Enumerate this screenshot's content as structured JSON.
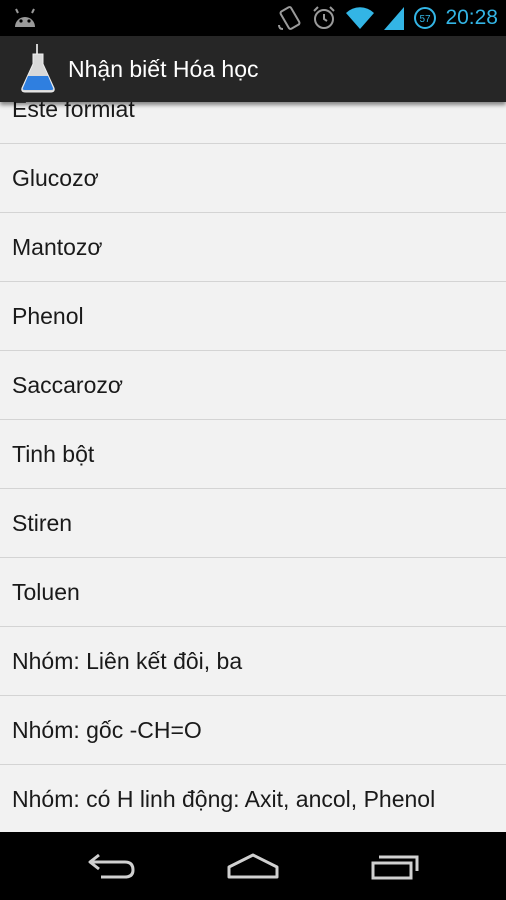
{
  "status_bar": {
    "time": "20:28",
    "battery_level": "57",
    "icons": [
      "android-debug-icon",
      "rotation-lock-icon",
      "alarm-icon",
      "wifi-icon",
      "signal-icon",
      "battery-icon"
    ],
    "accent_color": "#33b5e5"
  },
  "action_bar": {
    "title": "Nhận biết Hóa học",
    "icon": "flask-icon",
    "background": "#262626"
  },
  "list": {
    "items": [
      "Este formiat",
      "Glucozơ",
      "Mantozơ",
      "Phenol",
      "Saccarozơ",
      "Tinh bột",
      "Stiren",
      "Toluen",
      "Nhóm: Liên kết đôi, ba",
      "Nhóm: gốc -CH=O",
      "Nhóm: có H linh động: Axit, ancol, Phenol"
    ]
  },
  "nav_bar": {
    "buttons": [
      "back-icon",
      "home-icon",
      "recent-apps-icon"
    ]
  }
}
